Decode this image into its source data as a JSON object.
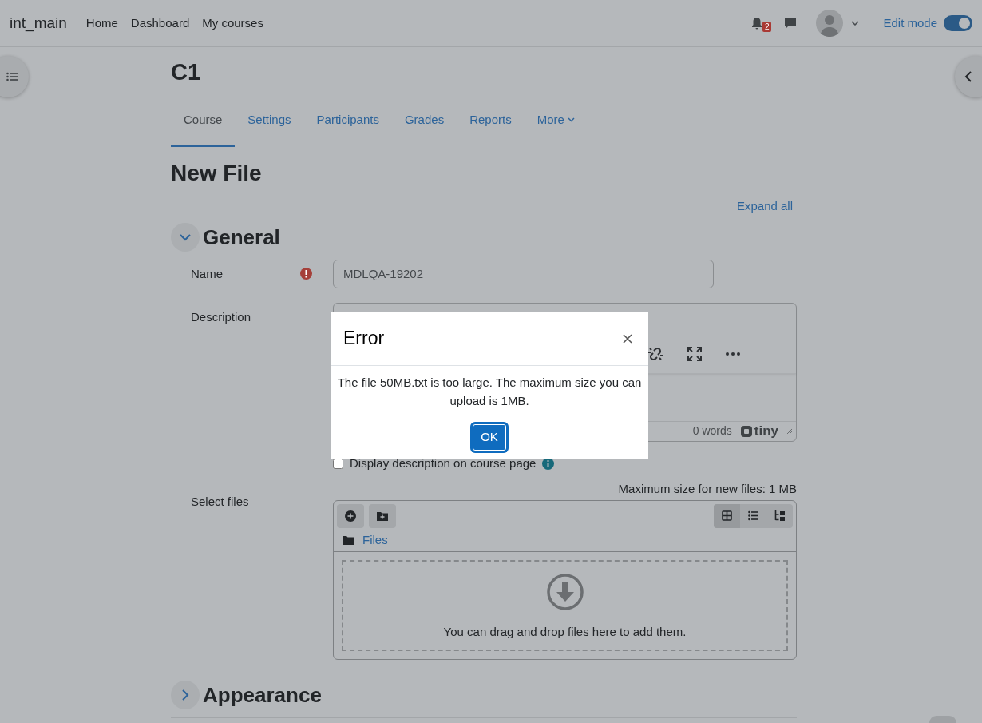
{
  "navbar": {
    "site_name": "int_main",
    "links": [
      {
        "label": "Home"
      },
      {
        "label": "Dashboard"
      },
      {
        "label": "My courses"
      }
    ],
    "notification_count": "2",
    "edit_mode": {
      "label": "Edit mode",
      "on": true
    }
  },
  "course": {
    "title": "C1",
    "tabs": [
      {
        "label": "Course",
        "selected": true,
        "kind": "link"
      },
      {
        "label": "Settings",
        "selected": false,
        "kind": "link"
      },
      {
        "label": "Participants",
        "selected": false,
        "kind": "link"
      },
      {
        "label": "Grades",
        "selected": false,
        "kind": "link"
      },
      {
        "label": "Reports",
        "selected": false,
        "kind": "link"
      },
      {
        "label": "More",
        "selected": false,
        "kind": "dropdown"
      }
    ]
  },
  "page_title": "New File",
  "expand_all": "Expand all",
  "general": {
    "title": "General",
    "expanded": true,
    "name": {
      "label": "Name",
      "required": true,
      "value": "MDLQA-19202"
    },
    "description": {
      "label": "Description",
      "word_count": "0 words",
      "brand": "tiny"
    },
    "display_checkbox": {
      "label": "Display description on course page",
      "checked": false
    },
    "select_files": {
      "label": "Select files",
      "max_size": "Maximum size for new files: 1 MB",
      "path": "Files",
      "views": [
        {
          "kind": "icons",
          "selected": true
        },
        {
          "kind": "list",
          "selected": false
        },
        {
          "kind": "tree",
          "selected": false
        }
      ],
      "drop_hint": "You can drag and drop files here to add them."
    }
  },
  "appearance": {
    "title": "Appearance",
    "expanded": false
  },
  "modal": {
    "title": "Error",
    "message": "The file 50MB.txt is too large. The maximum size you can upload is 1MB.",
    "button": "OK"
  }
}
